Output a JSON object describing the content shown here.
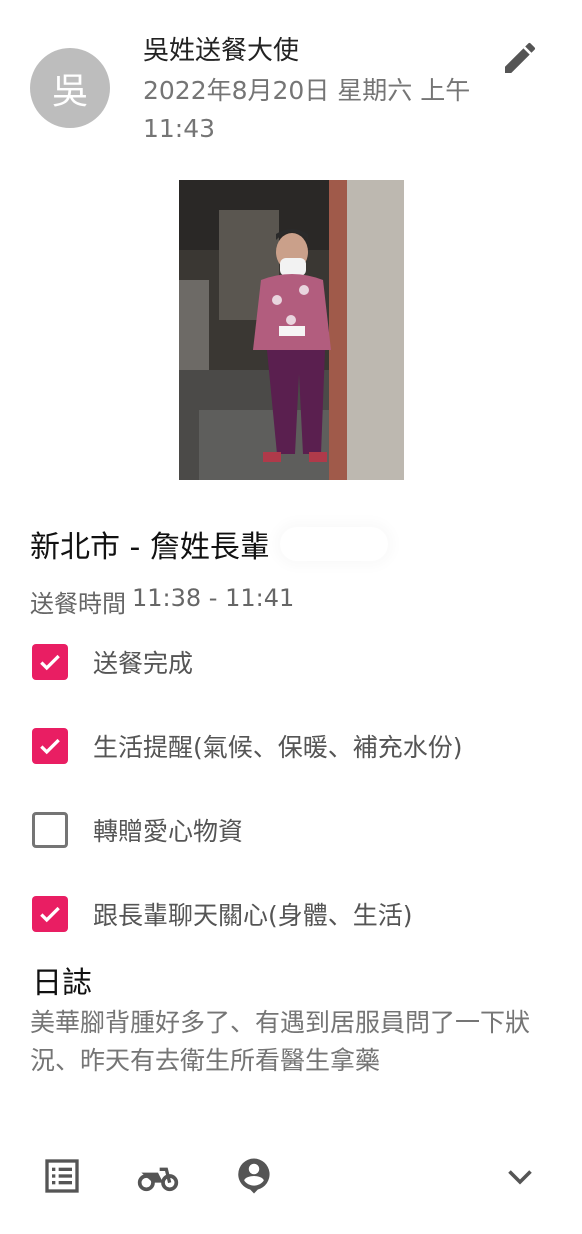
{
  "header": {
    "avatar_initial": "吳",
    "author": "吳姓送餐大使",
    "datetime": "2022年8月20日 星期六 上午11:43"
  },
  "record": {
    "title": "新北市 - 詹姓長輩",
    "delivery_time_label": "送餐時間",
    "delivery_time": "11:38 - 11:41"
  },
  "checklist": [
    {
      "label": "送餐完成",
      "checked": true
    },
    {
      "label": "生活提醒(氣候、保暖、補充水份)",
      "checked": true
    },
    {
      "label": "轉贈愛心物資",
      "checked": false
    },
    {
      "label": "跟長輩聊天關心(身體、生活)",
      "checked": true
    }
  ],
  "journal": {
    "heading": "日誌",
    "text": "美華腳背腫好多了、有遇到居服員問了一下狀況、昨天有去衛生所看醫生拿藥"
  },
  "colors": {
    "accent": "#e91e63",
    "secondary_text": "#757575",
    "icon": "#555555"
  },
  "icons": [
    "edit-icon",
    "list-icon",
    "motorbike-icon",
    "person-pin-icon",
    "chevron-down-icon"
  ]
}
